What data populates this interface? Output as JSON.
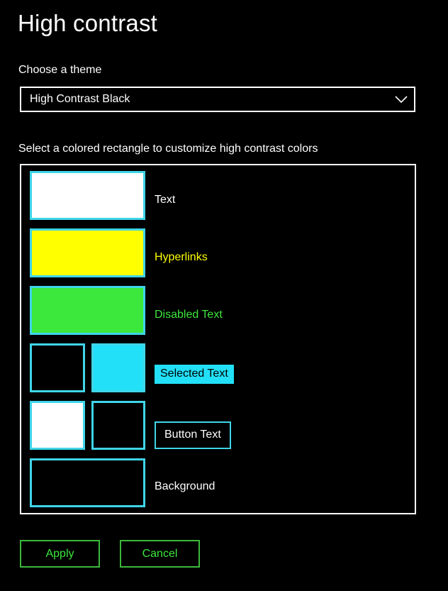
{
  "page": {
    "title": "High contrast",
    "background_color": "#000000",
    "text_color": "#ffffff"
  },
  "theme_section": {
    "label": "Choose a theme",
    "dropdown": {
      "selected_value": "High Contrast Black",
      "chevron_icon": "chevron-down-icon"
    }
  },
  "colors_section": {
    "label": "Select a colored rectangle to customize high contrast colors",
    "swatch_border_color": "#3fd5e8",
    "panel_border_color": "#ffffff",
    "rows": [
      {
        "name": "text",
        "label": "Text",
        "label_style": "plain",
        "label_color": "#ffffff",
        "swatches": [
          {
            "name": "text-foreground",
            "color": "#ffffff",
            "size": "wide"
          }
        ]
      },
      {
        "name": "hyperlinks",
        "label": "Hyperlinks",
        "label_style": "hyperlink",
        "label_color": "#ffff00",
        "swatches": [
          {
            "name": "hyperlink-foreground",
            "color": "#ffff00",
            "size": "wide"
          }
        ]
      },
      {
        "name": "disabled-text",
        "label": "Disabled Text",
        "label_style": "disabled",
        "label_color": "#3ce83c",
        "swatches": [
          {
            "name": "disabled-text-foreground",
            "color": "#3ce83c",
            "size": "wide"
          }
        ]
      },
      {
        "name": "selected-text",
        "label": "Selected Text",
        "label_style": "selected",
        "label_color": "#000000",
        "label_background": "#22e0f8",
        "swatches": [
          {
            "name": "selected-text-foreground",
            "color": "#000000",
            "size": "small-a"
          },
          {
            "name": "selected-text-background",
            "color": "#22e0f8",
            "size": "small-b"
          }
        ]
      },
      {
        "name": "button-text",
        "label": "Button Text",
        "label_style": "button",
        "label_color": "#ffffff",
        "label_background": "#000000",
        "swatches": [
          {
            "name": "button-text-foreground",
            "color": "#ffffff",
            "size": "small-a"
          },
          {
            "name": "button-text-background",
            "color": "#000000",
            "size": "small-b"
          }
        ]
      },
      {
        "name": "background",
        "label": "Background",
        "label_style": "plain",
        "label_color": "#ffffff",
        "swatches": [
          {
            "name": "background-color",
            "color": "#000000",
            "size": "wide"
          }
        ]
      }
    ]
  },
  "actions": {
    "apply_label": "Apply",
    "cancel_label": "Cancel",
    "border_color": "#3cb83c",
    "text_color": "#3ce83c"
  }
}
